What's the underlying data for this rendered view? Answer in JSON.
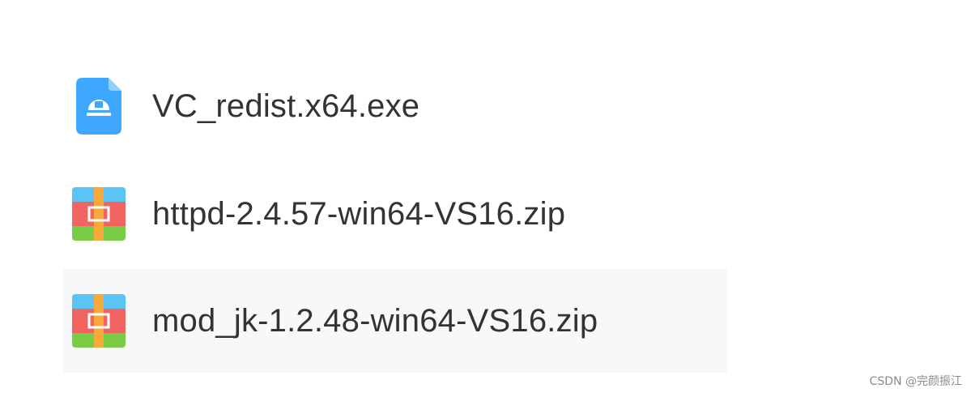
{
  "files": [
    {
      "name": "VC_redist.x64.exe",
      "icon": "installer-file-icon",
      "selected": false
    },
    {
      "name": "httpd-2.4.57-win64-VS16.zip",
      "icon": "zip-archive-icon",
      "selected": false
    },
    {
      "name": "mod_jk-1.2.48-win64-VS16.zip",
      "icon": "zip-archive-icon",
      "selected": true
    }
  ],
  "watermark": "CSDN @完颜振江",
  "colors": {
    "installer_blue": "#3ea8ff",
    "zip_blue": "#5bc4f5",
    "zip_red": "#f26462",
    "zip_green": "#7acb45",
    "zip_orange": "#f7a93b",
    "selected_row_bg": "#f7f8fa",
    "text": "#333333"
  }
}
